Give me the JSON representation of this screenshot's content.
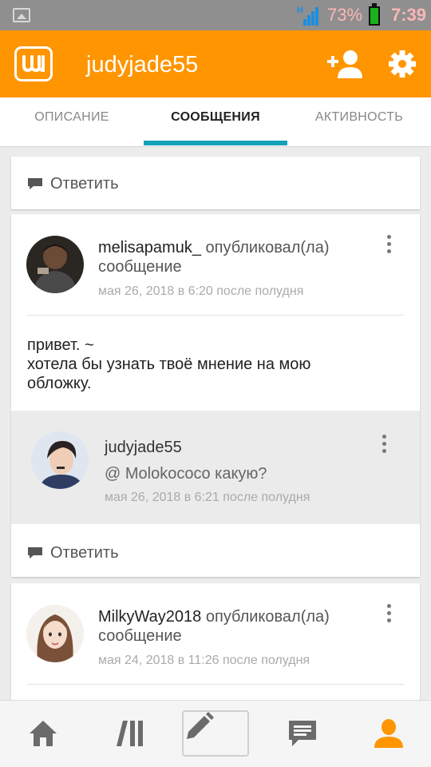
{
  "status_bar": {
    "battery_percent": "73%",
    "time": "7:39",
    "network_type": "H",
    "icons": [
      "image-icon",
      "signal-icon",
      "battery-icon"
    ]
  },
  "app_bar": {
    "title": "judyjade55",
    "logo_icon": "wattpad-logo-icon",
    "actions": [
      "add-user-icon",
      "settings-gear-icon"
    ],
    "accent_color": "#ff9500"
  },
  "tabs": [
    {
      "label": "ОПИСАНИЕ",
      "active": false
    },
    {
      "label": "СООБЩЕНИЯ",
      "active": true
    },
    {
      "label": "АКТИВНОСТЬ",
      "active": false
    }
  ],
  "tab_indicator_color": "#13a2b8",
  "reply_label": "Ответить",
  "posts": [
    {
      "author": "melisapamuk_",
      "verb_line1": "опубликовал(ла)",
      "verb_line2": "сообщение",
      "time": "мая 26, 2018 в 6:20 после полудня",
      "body_lines": [
        "привет. ~",
        "хотела бы узнать твоё мнение на мою",
        "обложку."
      ],
      "reply": {
        "author": "judyjade55",
        "text": "@ Molokococo  какую?",
        "time": "мая 26, 2018 в 6:21 после полудня"
      }
    },
    {
      "author": "MilkyWay2018",
      "verb_line1": "опубликовал(ла)",
      "verb_line2": "сообщение",
      "time": "мая 24, 2018 в 11:26 после полудня"
    }
  ],
  "bottom_nav": [
    {
      "icon": "home-icon",
      "active": false
    },
    {
      "icon": "library-icon",
      "active": false
    },
    {
      "icon": "write-pencil-icon",
      "active": false
    },
    {
      "icon": "messages-icon",
      "active": false
    },
    {
      "icon": "profile-icon",
      "active": true
    }
  ]
}
